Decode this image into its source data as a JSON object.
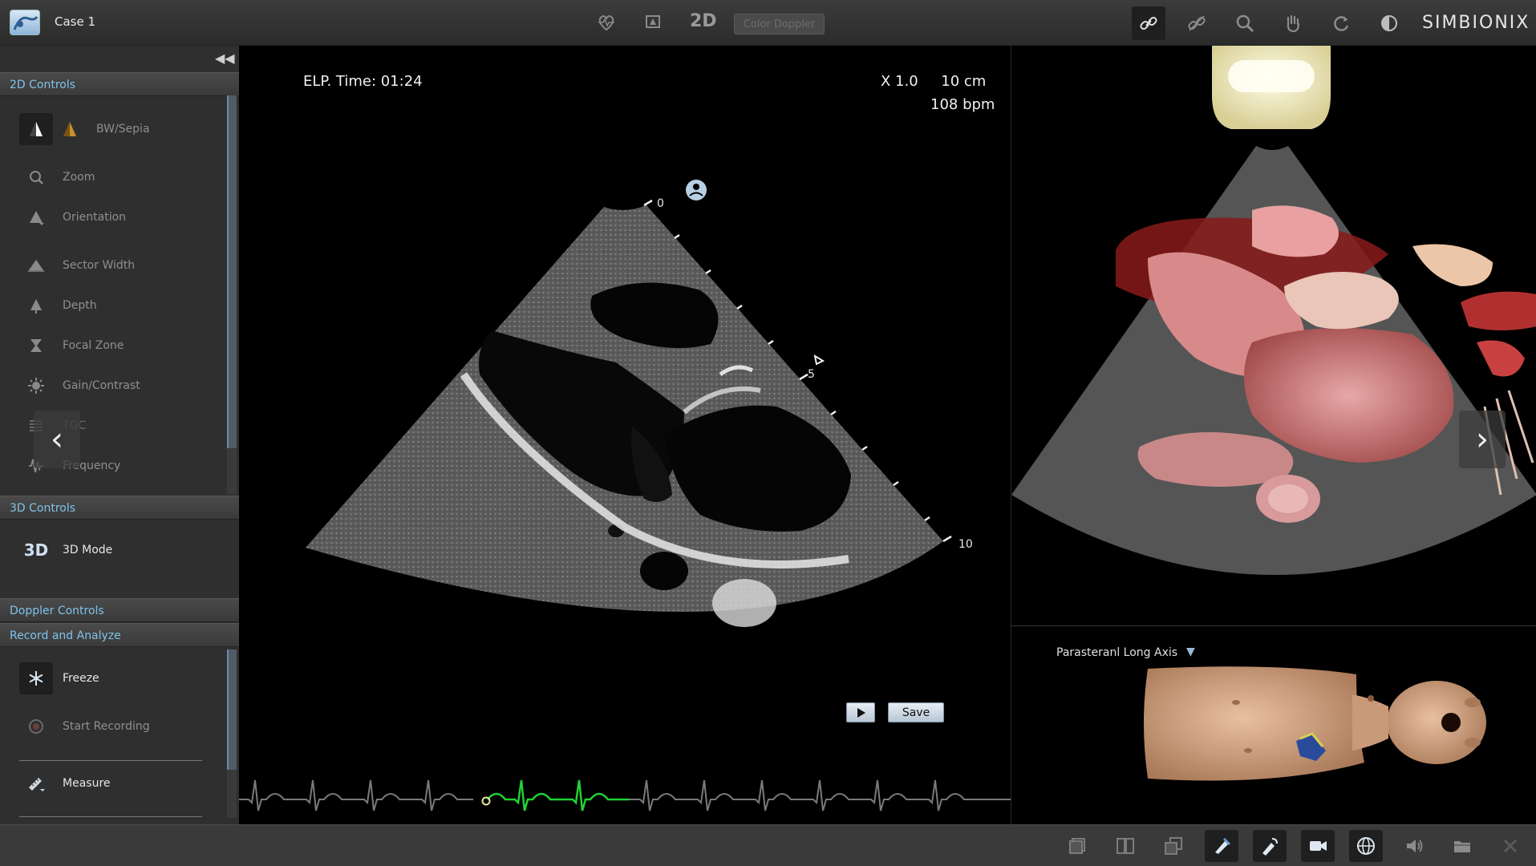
{
  "window": {
    "case_title": "Case 1",
    "brand": "SIMBIONIX"
  },
  "toolbar": {
    "mode_2d_label": "2D",
    "color_doppler_label": "Color Doppler",
    "left_icons": [
      "heart-pulse-icon",
      "probe-marker-icon"
    ],
    "right_icons": [
      "link-icon",
      "unlink-icon",
      "magnify-icon",
      "hand-icon",
      "rotate-icon",
      "contrast-icon"
    ]
  },
  "sidebar": {
    "sections": {
      "controls_2d": "2D Controls",
      "controls_3d": "3D Controls",
      "doppler": "Doppler Controls",
      "record": "Record and Analyze"
    },
    "items_2d": [
      {
        "label": "BW/Sepia",
        "icon": "bw-sepia-icon"
      },
      {
        "label": "Zoom",
        "icon": "zoom-icon"
      },
      {
        "label": "Orientation",
        "icon": "orientation-icon"
      },
      {
        "label": "Sector Width",
        "icon": "sector-width-icon"
      },
      {
        "label": "Depth",
        "icon": "depth-icon"
      },
      {
        "label": "Focal Zone",
        "icon": "focal-zone-icon"
      },
      {
        "label": "Gain/Contrast",
        "icon": "gain-contrast-icon"
      },
      {
        "label": "TGC",
        "icon": "tgc-icon"
      },
      {
        "label": "Frequency",
        "icon": "frequency-icon"
      }
    ],
    "items_3d": [
      {
        "label": "3D Mode",
        "icon_text": "3D"
      }
    ],
    "items_record": [
      {
        "label": "Freeze",
        "icon": "snowflake-icon"
      },
      {
        "label": "Start Recording",
        "icon": "record-icon"
      },
      {
        "label": "Measure",
        "icon": "ruler-icon"
      }
    ]
  },
  "ultrasound": {
    "elp_time": "ELP. Time: 01:24",
    "zoom_depth": "X 1.0     10 cm",
    "heart_rate": "108 bpm",
    "depth_labels": [
      "0",
      "5",
      "10"
    ],
    "save_label": "Save"
  },
  "view_selector": {
    "value": "Parasteranl Long Axis"
  },
  "bottom_toolbar": {
    "icons": [
      "layout-single-icon",
      "layout-split-icon",
      "layout-overlap-icon",
      "probe-view-icon",
      "probe-tool-icon",
      "camera-icon",
      "globe-icon",
      "speaker-icon",
      "folder-icon",
      "close-icon"
    ]
  }
}
